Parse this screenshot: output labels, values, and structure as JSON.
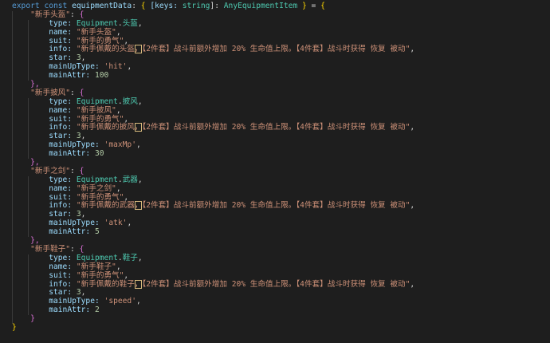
{
  "header": {
    "kw_export": "export",
    "kw_const": "const",
    "var_name": "equipmentData",
    "colon": ":",
    "index_open": "[keys:",
    "index_type": "string",
    "index_close": "]:",
    "type_name": "AnyEquipmentItem",
    "assign": "=",
    "brace_open": "{",
    "brace_close": "}"
  },
  "items": [
    {
      "key": "\"新手头盔\"",
      "type_obj": "Equipment",
      "type_member": "头盔",
      "name": "\"新手头盔\"",
      "suit": "\"新手的勇气\"",
      "info_a": "\"新手佩戴的头盔",
      "info_b": "【2件套】战斗前额外增加 20% 生命值上限。【4件套】战斗时获得 恢复 被动\"",
      "star": "3",
      "mainUpType": "'hit'",
      "mainAttr": "100",
      "close": "},"
    },
    {
      "key": "\"新手披风\"",
      "type_obj": "Equipment",
      "type_member": "披风",
      "name": "\"新手披风\"",
      "suit": "\"新手的勇气\"",
      "info_a": "\"新手佩戴的披风",
      "info_b": "【2件套】战斗前额外增加 20% 生命值上限。【4件套】战斗时获得 恢复 被动\"",
      "star": "3",
      "mainUpType": "'maxMp'",
      "mainAttr": "30",
      "close": "},"
    },
    {
      "key": "\"新手之剑\"",
      "type_obj": "Equipment",
      "type_member": "武器",
      "name": "\"新手之剑\"",
      "suit": "\"新手的勇气\"",
      "info_a": "\"新手佩戴的武器",
      "info_b": "【2件套】战斗前额外增加 20% 生命值上限。【4件套】战斗时获得 恢复 被动\"",
      "star": "3",
      "mainUpType": "'atk'",
      "mainAttr": "5",
      "close": "},"
    },
    {
      "key": "\"新手鞋子\"",
      "type_obj": "Equipment",
      "type_member": "鞋子",
      "name": "\"新手鞋子\"",
      "suit": "\"新手的勇气\"",
      "info_a": "\"新手佩戴的鞋子",
      "info_b": "【2件套】战斗前额外增加 20% 生命值上限。【4件套】战斗时获得 恢复 被动\"",
      "star": "3",
      "mainUpType": "'speed'",
      "mainAttr": "2",
      "close": "}"
    }
  ],
  "props": {
    "type": "type:",
    "name": "name:",
    "suit": "suit:",
    "info": "info:",
    "star": "star:",
    "mainUpType": "mainUpType:",
    "mainAttr": "mainAttr:"
  },
  "colors": {
    "background": "#1e1e1e",
    "keyword": "#569cd6",
    "variable": "#9cdcfe",
    "type": "#4ec9b0",
    "string": "#ce9178",
    "number": "#b5cea8"
  }
}
